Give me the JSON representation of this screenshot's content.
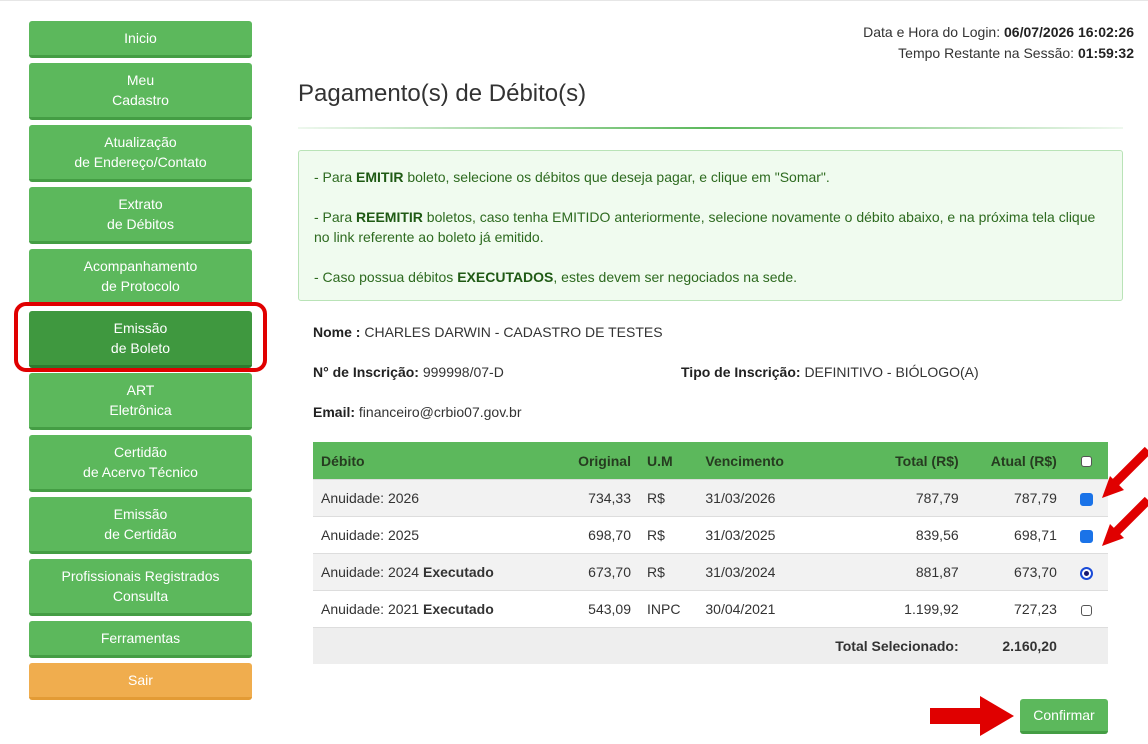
{
  "sidebar": {
    "items": [
      {
        "label": "Inicio"
      },
      {
        "label": "Meu\nCadastro"
      },
      {
        "label": "Atualização\nde Endereço/Contato"
      },
      {
        "label": "Extrato\nde Débitos"
      },
      {
        "label": "Acompanhamento\nde Protocolo"
      },
      {
        "label": "Emissão\nde Boleto"
      },
      {
        "label": "ART\nEletrônica"
      },
      {
        "label": "Certidão\nde Acervo Técnico"
      },
      {
        "label": "Emissão\nde Certidão"
      },
      {
        "label": "Profissionais Registrados\nConsulta"
      },
      {
        "label": "Ferramentas"
      },
      {
        "label": "Sair"
      }
    ]
  },
  "session": {
    "login_label": "Data e Hora do Login:",
    "login_value": "06/07/2026 16:02:26",
    "remaining_label": "Tempo Restante na Sessão:",
    "remaining_value": "01:59:32"
  },
  "page_title": "Pagamento(s) de Débito(s)",
  "alert": {
    "l1_pre": "- Para ",
    "l1_bold": "EMITIR",
    "l1_post": " boleto, selecione os débitos que deseja pagar, e clique em \"Somar\".",
    "l2_pre": "- Para ",
    "l2_bold": "REEMITIR",
    "l2_post": " boletos, caso tenha EMITIDO anteriormente, selecione novamente o débito abaixo, e na próxima tela clique no link referente ao boleto já emitido.",
    "l3_pre": "- Caso possua débitos ",
    "l3_bold": "EXECUTADOS",
    "l3_post": ", estes devem ser negociados na sede."
  },
  "registrant": {
    "name_label": "Nome :",
    "name": "CHARLES DARWIN - CADASTRO DE TESTES",
    "inscricao_label": "N° de Inscrição:",
    "inscricao": "999998/07-D",
    "tipo_label": "Tipo de Inscrição:",
    "tipo": "DEFINITIVO - BIÓLOGO(A)",
    "email_label": "Email:",
    "email": "financeiro@crbio07.gov.br"
  },
  "table": {
    "headers": [
      "Débito",
      "Original",
      "U.M",
      "Vencimento",
      "Total (R$)",
      "Atual (R$)"
    ],
    "rows": [
      {
        "debito": "Anuidade: 2026",
        "tag": "",
        "original": "734,33",
        "um": "R$",
        "vencimento": "31/03/2026",
        "total": "787,79",
        "atual": "787,79",
        "selected": true
      },
      {
        "debito": "Anuidade: 2025",
        "tag": "",
        "original": "698,70",
        "um": "R$",
        "vencimento": "31/03/2025",
        "total": "839,56",
        "atual": "698,71",
        "selected": true
      },
      {
        "debito": "Anuidade: 2024",
        "tag": "Executado",
        "original": "673,70",
        "um": "R$",
        "vencimento": "31/03/2024",
        "total": "881,87",
        "atual": "673,70",
        "selected": true
      },
      {
        "debito": "Anuidade: 2021",
        "tag": "Executado",
        "original": "543,09",
        "um": "INPC",
        "vencimento": "30/04/2021",
        "total": "1.199,92",
        "atual": "727,23",
        "selected": false
      }
    ],
    "total_label": "Total Selecionado:",
    "total_value": "2.160,20"
  },
  "confirm_label": "Confirmar",
  "colors": {
    "primary_green": "#5cb85c",
    "active_green": "#3f983f",
    "orange": "#f0ad4e",
    "highlight_red": "#e00000"
  }
}
